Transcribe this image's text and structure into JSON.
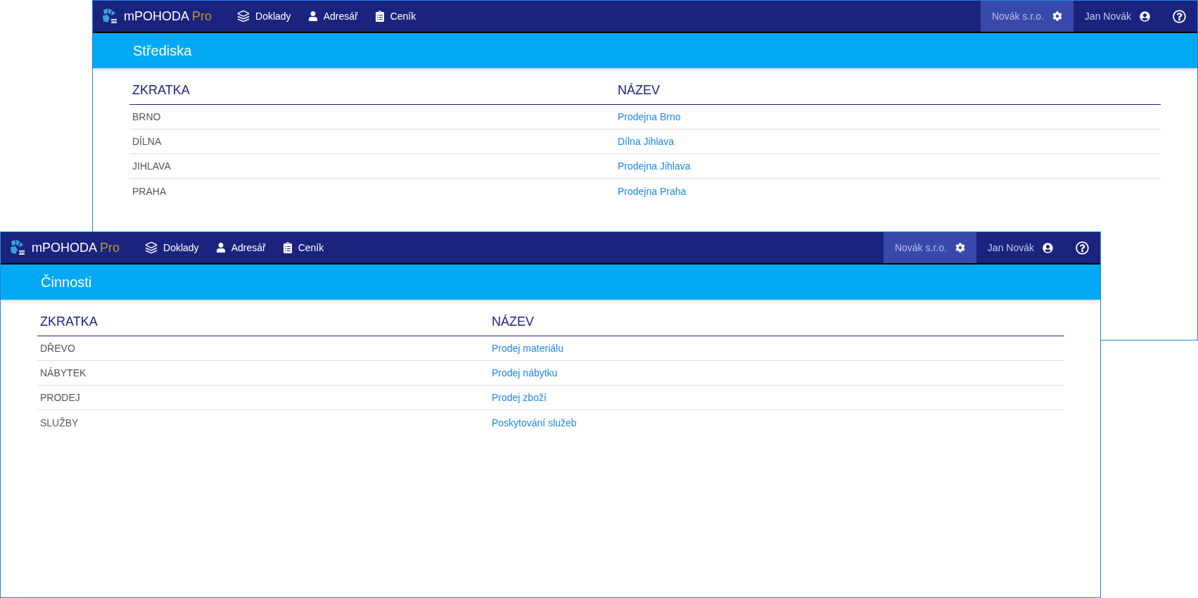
{
  "windows": [
    {
      "brand": {
        "name": "mPOHODA",
        "edition": "Pro"
      },
      "nav": [
        "Doklady",
        "Adresář",
        "Ceník"
      ],
      "company": "Novák s.r.o.",
      "user": "Jan Novák",
      "title": "Střediska",
      "columns": [
        "ZKRATKA",
        "NÁZEV"
      ],
      "rows": [
        {
          "code": "BRNO",
          "name": "Prodejna Brno"
        },
        {
          "code": "DÍLNA",
          "name": "Dílna Jihlava"
        },
        {
          "code": "JIHLAVA",
          "name": "Prodejna Jihlava"
        },
        {
          "code": "PRAHA",
          "name": "Prodejna Praha"
        }
      ]
    },
    {
      "brand": {
        "name": "mPOHODA",
        "edition": "Pro"
      },
      "nav": [
        "Doklady",
        "Adresář",
        "Ceník"
      ],
      "company": "Novák s.r.o.",
      "user": "Jan Novák",
      "title": "Činnosti",
      "columns": [
        "ZKRATKA",
        "NÁZEV"
      ],
      "rows": [
        {
          "code": "DŘEVO",
          "name": "Prodej materiálu"
        },
        {
          "code": "NÁBYTEK",
          "name": "Prodej nábytku"
        },
        {
          "code": "PRODEJ",
          "name": "Prodej zboží"
        },
        {
          "code": "SLUŽBY",
          "name": "Poskytování služeb"
        }
      ]
    }
  ]
}
